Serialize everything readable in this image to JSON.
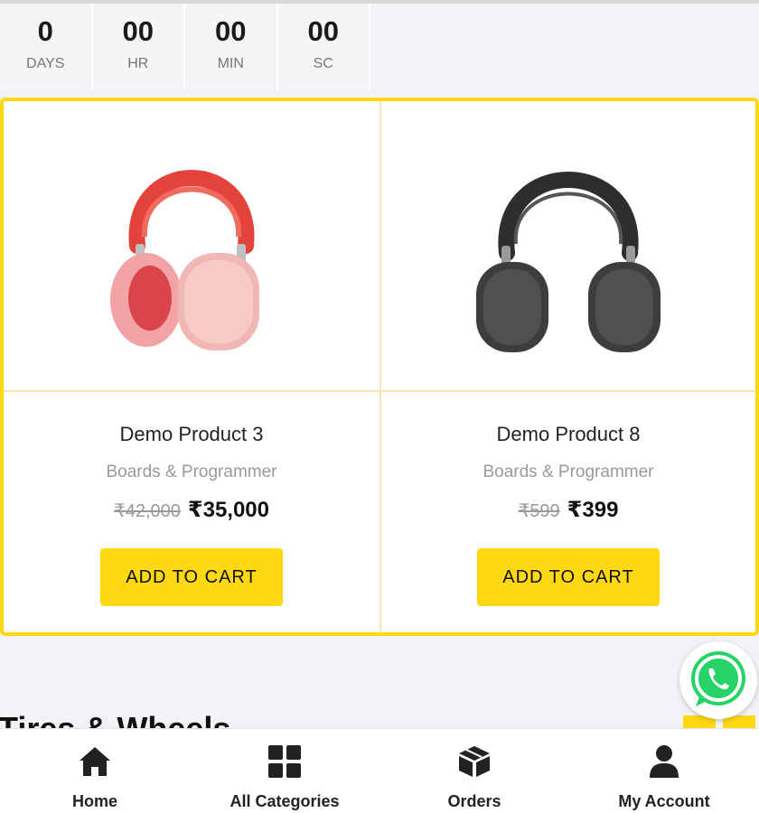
{
  "countdown": [
    {
      "value": "0",
      "unit": "DAYS"
    },
    {
      "value": "00",
      "unit": "HR"
    },
    {
      "value": "00",
      "unit": "MIN"
    },
    {
      "value": "00",
      "unit": "SC"
    }
  ],
  "products": [
    {
      "name": "Demo Product 3",
      "category": "Boards & Programmer",
      "mrp": "₹42,000",
      "price": "₹35,000",
      "button": "ADD TO CART",
      "image_icon": "headphones-pink-icon"
    },
    {
      "name": "Demo Product 8",
      "category": "Boards & Programmer",
      "mrp": "₹599",
      "price": "₹399",
      "button": "ADD TO CART",
      "image_icon": "headphones-black-icon"
    }
  ],
  "section_title": "Tires & Wheels",
  "nav": [
    {
      "label": "Home",
      "icon": "home-icon"
    },
    {
      "label": "All Categories",
      "icon": "grid-icon"
    },
    {
      "label": "Orders",
      "icon": "box-icon"
    },
    {
      "label": "My Account",
      "icon": "user-icon"
    }
  ],
  "colors": {
    "accent": "#ffd814",
    "whatsapp": "#25d366"
  }
}
